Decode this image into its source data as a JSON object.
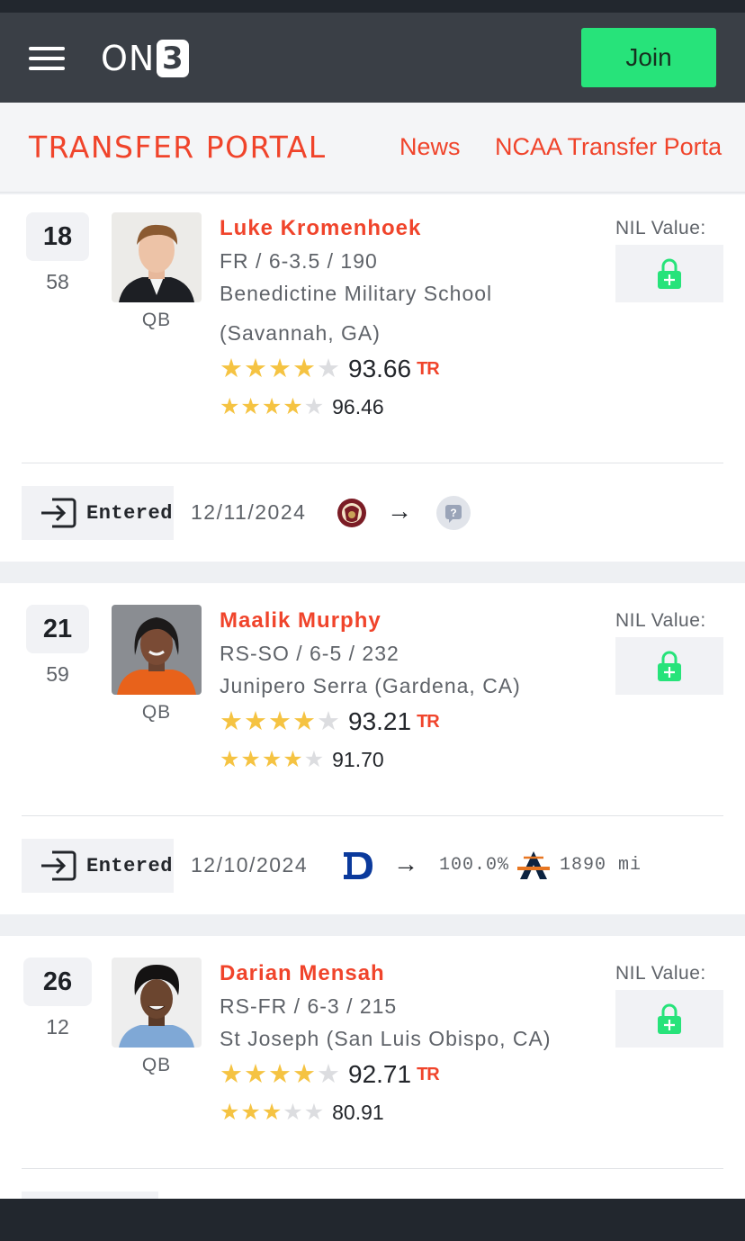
{
  "header": {
    "menu_icon": "hamburger-menu-icon",
    "logo_text": "ON",
    "logo_digit": "3",
    "join_label": "Join",
    "join_color": "#27e37a"
  },
  "subnav": {
    "brand": "TRANSFER PORTAL",
    "links": [
      "News",
      "NCAA Transfer Porta"
    ]
  },
  "players": [
    {
      "rank": "18",
      "sub_rank": "58",
      "position": "QB",
      "name": "Luke Kromenhoek",
      "class_line": "FR / 6-3.5 / 190",
      "school_line1": "Benedictine Military School",
      "school_line2": "(Savannah, GA)",
      "rating_main": "93.66",
      "rating_main_stars": 4,
      "rating_main_badge": "TR",
      "rating_secondary": "96.46",
      "rating_secondary_stars": 4,
      "nil_label": "NIL Value:",
      "status": "Entered",
      "date": "12/11/2024",
      "from_school_icon": "florida-state-logo",
      "to_school_icon": "unknown-school-icon",
      "to_pct": "",
      "distance": ""
    },
    {
      "rank": "21",
      "sub_rank": "59",
      "position": "QB",
      "name": "Maalik Murphy",
      "class_line": "RS-SO / 6-5 / 232",
      "school_line1": "Junipero Serra (Gardena, CA)",
      "school_line2": "",
      "rating_main": "93.21",
      "rating_main_stars": 4,
      "rating_main_badge": "TR",
      "rating_secondary": "91.70",
      "rating_secondary_stars": 4,
      "nil_label": "NIL Value:",
      "status": "Entered",
      "date": "12/10/2024",
      "from_school_icon": "duke-logo",
      "to_school_icon": "auburn-logo",
      "to_pct": "100.0%",
      "distance": "1890 mi"
    },
    {
      "rank": "26",
      "sub_rank": "12",
      "position": "QB",
      "name": "Darian Mensah",
      "class_line": "RS-FR / 6-3 / 215",
      "school_line1": "St Joseph (San Luis Obispo, CA)",
      "school_line2": "",
      "rating_main": "92.71",
      "rating_main_stars": 4,
      "rating_main_badge": "TR",
      "rating_secondary": "80.91",
      "rating_secondary_stars": 3,
      "nil_label": "NIL Value:"
    }
  ],
  "colors": {
    "accent": "#f0442b",
    "star_on": "#f5c342",
    "star_off": "#dcdde0",
    "lock": "#27e37a",
    "header_bg": "#3a3f46"
  }
}
